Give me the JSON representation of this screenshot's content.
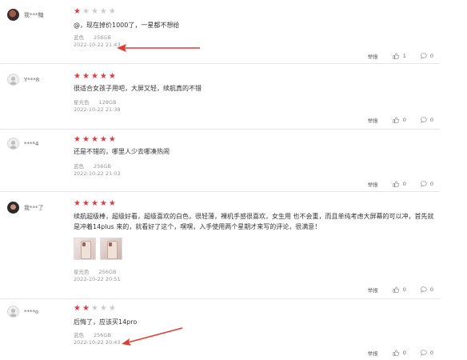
{
  "reviews": [
    {
      "username": "我***糖",
      "avatar": "dark",
      "stars": 1,
      "content": "@，现在掉价1000了，一星都不想给",
      "color": "蓝色",
      "storage": "256GB",
      "time": "2022-10-22 21:43",
      "report": "举报",
      "likes": "1",
      "replies": "0"
    },
    {
      "username": "Y***8",
      "avatar": "default",
      "stars": 5,
      "content": "很适合女孩子用吧，大屏又轻，续航真的不错",
      "color": "星光色",
      "storage": "128GB",
      "time": "2022-10-22 21:38",
      "report": "举报",
      "likes": "0",
      "replies": "0"
    },
    {
      "username": "****4",
      "avatar": "default",
      "stars": 5,
      "content": "还是不错的，哪里人少去哪凑热闹",
      "color": "蓝色",
      "storage": "256GB",
      "time": "2022-10-22 21:03",
      "report": "举报",
      "likes": "0",
      "replies": "0"
    },
    {
      "username": "我***了",
      "avatar": "photo",
      "stars": 5,
      "content": "续航超级棒，超级好看，超级喜欢的白色，很轻薄，裸机手感很喜欢，女生用 也不会重，而且单纯考虑大屏幕的可以冲，首先就是冲着14plus 来的，就看好了这个，嘿嘿，入手使用两个星期才来写的评论，很满意！",
      "color": "星光色",
      "storage": "256GB",
      "time": "2022-10-22 20:51",
      "report": "举报",
      "likes": "0",
      "replies": "0"
    },
    {
      "username": "****o",
      "avatar": "default",
      "stars": 2,
      "content": "后悔了，应该买14pro",
      "color": "蓝色",
      "storage": "256GB",
      "time": "2022-10-22 20:43",
      "report": "举报",
      "likes": "0",
      "replies": "0"
    }
  ],
  "icons": {
    "star": "star-icon",
    "like": "thumbs-up-icon",
    "reply": "comment-icon"
  },
  "colors": {
    "star_on": "#e4393c",
    "star_off": "#cccccc",
    "annotation_arrow": "#e03c31"
  }
}
